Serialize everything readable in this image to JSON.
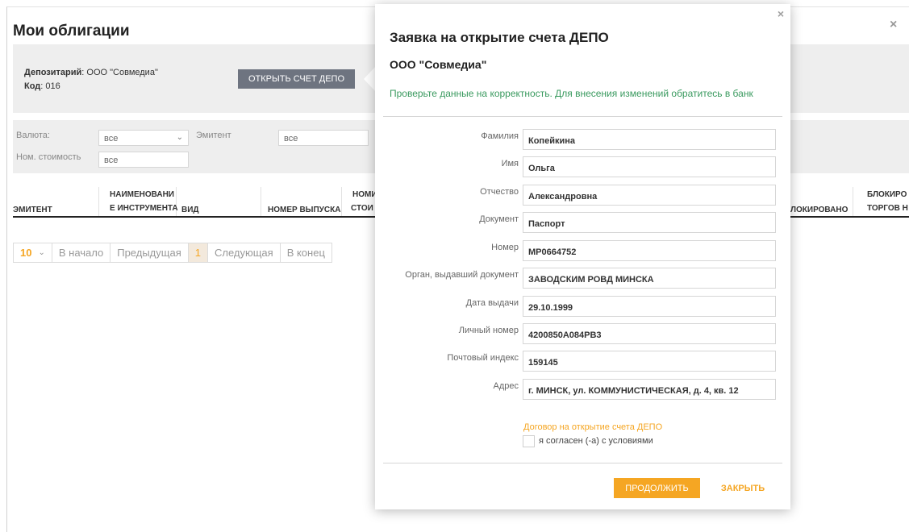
{
  "page": {
    "title": "Мои облигации",
    "close_glyph": "×"
  },
  "depository": {
    "label": "Депозитарий",
    "value": ": ООО \"Совмедиа\"",
    "code_label": "Код",
    "code_value": ": 016",
    "open_button": "ОТКРЫТЬ СЧЕТ ДЕПО"
  },
  "filters": {
    "currency_label": "Валюта:",
    "currency_value": "все",
    "issuer_label": "Эмитент",
    "issuer_value": "все",
    "nominal_label": "Ном. стоимость",
    "nominal_value": "все"
  },
  "table": {
    "headers": [
      "ЭМИТЕНТ",
      "НАИМЕНОВАНИ",
      "Е ИНСТРУМЕНТА",
      "ВИД",
      "НОМЕР ВЫПУСКА",
      "НОМИ",
      "СТОИ",
      "ЛОКИРОВАНО",
      "БЛОКИРО",
      "ТОРГОВ Н"
    ]
  },
  "pagination": {
    "page_size": "10",
    "first": "В начало",
    "prev": "Предыдущая",
    "current": "1",
    "next": "Следующая",
    "last": "В конец"
  },
  "modal": {
    "close_glyph": "×",
    "title": "Заявка на открытие счета ДЕПО",
    "org": "ООО \"Совмедиа\"",
    "note": "Проверьте данные на корректность. Для внесения изменений обратитесь в банк",
    "fields": [
      {
        "label": "Фамилия",
        "value": "Копейкина"
      },
      {
        "label": "Имя",
        "value": "Ольга"
      },
      {
        "label": "Отчество",
        "value": "Александровна"
      },
      {
        "label": "Документ",
        "value": "Паспорт"
      },
      {
        "label": "Номер",
        "value": "MP0664752"
      },
      {
        "label": "Орган, выдавший документ",
        "value": "ЗАВОДСКИМ РОВД МИНСКА"
      },
      {
        "label": "Дата выдачи",
        "value": "29.10.1999"
      },
      {
        "label": "Личный номер",
        "value": "4200850A084PB3"
      },
      {
        "label": "Почтовый индекс",
        "value": "159145"
      },
      {
        "label": "Адрес",
        "value": "г. МИНСК, ул. КОММУНИСТИЧЕСКАЯ, д. 4, кв. 12"
      }
    ],
    "agreement_link": "Договор на открытие счета ДЕПО",
    "agreement_checkbox_label": "я согласен (-а) с условиями",
    "continue_button": "ПРОДОЛЖИТЬ",
    "close_button": "ЗАКРЫТЬ"
  },
  "colors": {
    "accent": "#f5a623",
    "note_green": "#3a9a5f",
    "button_gray": "#6e7480",
    "panel_gray": "#eeeeee"
  }
}
